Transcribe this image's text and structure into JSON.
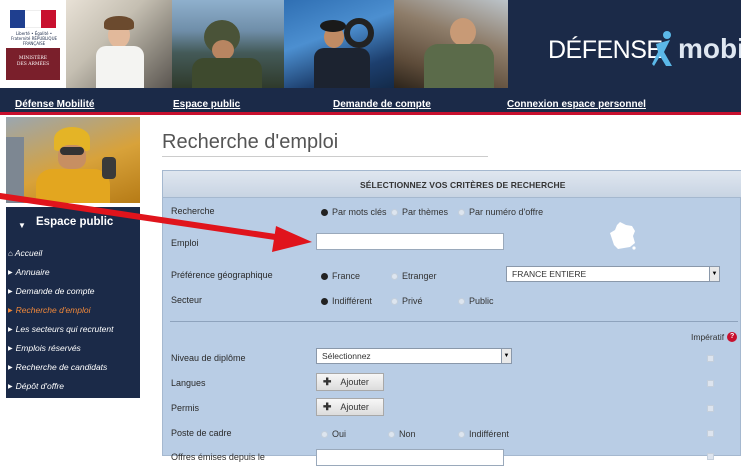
{
  "colors": {
    "navy": "#1b2a48",
    "red": "#c8102e",
    "form_bg": "#b9cde5",
    "active": "#f0883a",
    "arrow": "#e0141c"
  },
  "banner": {
    "republic_text": "Liberté • Égalité • Fraternité RÉPUBLIQUE FRANÇAISE",
    "ministry_line1": "MINISTÈRE",
    "ministry_line2": "DES ARMÉES",
    "brand_defense": "DÉFENSE",
    "brand_mobilite": "mobilite"
  },
  "topnav": [
    {
      "label": "Défense Mobilité"
    },
    {
      "label": "Espace public"
    },
    {
      "label": "Demande de compte"
    },
    {
      "label": "Connexion espace personnel"
    }
  ],
  "sidebar": {
    "header": "Espace public",
    "items": [
      {
        "label": "Accueil",
        "icon": "home-icon"
      },
      {
        "label": "Annuaire"
      },
      {
        "label": "Demande de compte"
      },
      {
        "label": "Recherche d'emploi",
        "active": true
      },
      {
        "label": "Les secteurs qui recrutent"
      },
      {
        "label": "Emplois réservés"
      },
      {
        "label": "Recherche de candidats"
      },
      {
        "label": "Dépôt d'offre"
      }
    ]
  },
  "main": {
    "title": "Recherche d'emploi",
    "form_header": "SÉLECTIONNEZ VOS CRITÈRES DE RECHERCHE",
    "recherche": {
      "label": "Recherche",
      "options": [
        "Par mots clés",
        "Par thèmes",
        "Par numéro d'offre"
      ],
      "selected": 0
    },
    "emploi": {
      "label": "Emploi",
      "value": ""
    },
    "geo": {
      "label": "Préférence géographique",
      "options": [
        "France",
        "Etranger"
      ],
      "selected": 0,
      "select_value": "FRANCE ENTIERE"
    },
    "secteur": {
      "label": "Secteur",
      "options": [
        "Indifférent",
        "Privé",
        "Public"
      ],
      "selected": 0
    },
    "imperatif": "Impératif",
    "diplome": {
      "label": "Niveau de diplôme",
      "select_value": "Sélectionnez"
    },
    "langues": {
      "label": "Langues",
      "button": "Ajouter"
    },
    "permis": {
      "label": "Permis",
      "button": "Ajouter"
    },
    "cadre": {
      "label": "Poste de cadre",
      "options": [
        "Oui",
        "Non",
        "Indifférent"
      ]
    },
    "offres": {
      "label": "Offres émises depuis le"
    }
  }
}
